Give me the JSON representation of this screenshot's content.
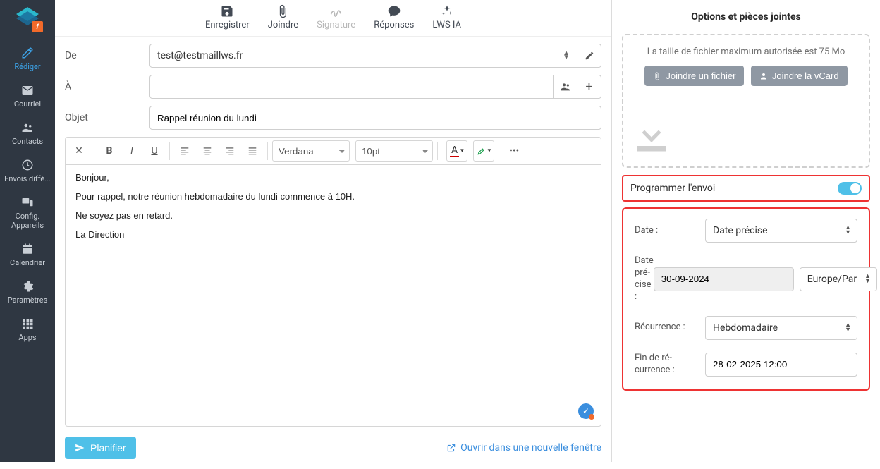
{
  "sidebar": {
    "items": [
      {
        "label": "Rédiger"
      },
      {
        "label": "Courriel"
      },
      {
        "label": "Contacts"
      },
      {
        "label": "Envois diffé..."
      },
      {
        "label": "Config. Appareils"
      },
      {
        "label": "Calendrier"
      },
      {
        "label": "Paramètres"
      },
      {
        "label": "Apps"
      }
    ]
  },
  "toolbar": {
    "save": "Enregistrer",
    "attach": "Joindre",
    "signature": "Signature",
    "responses": "Réponses",
    "ia": "LWS IA"
  },
  "fields": {
    "from_label": "De",
    "from_value": "test@testmaillws.fr",
    "to_label": "À",
    "to_value": "",
    "subject_label": "Objet",
    "subject_value": "Rappel réunion du lundi"
  },
  "editor": {
    "font": "Verdana",
    "size": "10pt",
    "body": [
      "Bonjour,",
      "Pour rappel, notre réunion hebdomadaire du lundi commence à 10H.",
      "Ne soyez pas en retard.",
      "La Direction"
    ]
  },
  "bottom": {
    "plan": "Planifier",
    "newwin": "Ouvrir dans une nouvelle fenêtre"
  },
  "options": {
    "title": "Options et pièces jointes",
    "maxsize": "La taille de fichier maximum autorisée est 75 Mo",
    "btn_attach": "Joindre un fichier",
    "btn_vcard": "Joindre la vCard",
    "schedule_label": "Programmer l'envoi",
    "rows": {
      "date_label": "Date :",
      "date_value": "Date précise",
      "precise_label": "Date pré-cise :",
      "precise_date": "30-09-2024 ",
      "precise_tz": "Europe/Par",
      "recurrence_label": "Récurrence :",
      "recurrence_value": "Hebdomadaire",
      "end_label": "Fin de ré-currence :",
      "end_value": "28-02-2025 12:00"
    }
  }
}
